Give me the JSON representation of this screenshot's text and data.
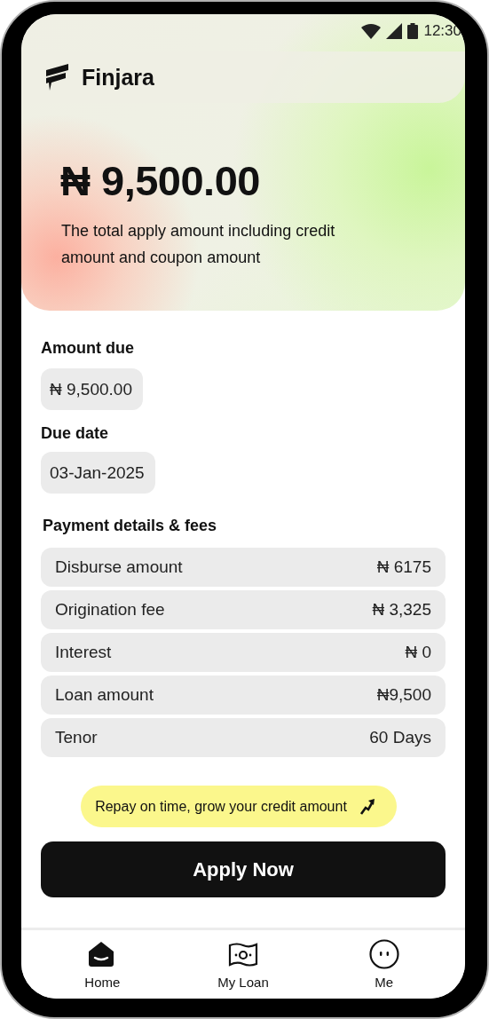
{
  "status_bar": {
    "time": "12:30"
  },
  "app": {
    "name": "Finjara"
  },
  "hero": {
    "amount": "₦ 9,500.00",
    "description": "The total apply amount including credit amount and coupon amount"
  },
  "amount_due": {
    "label": "Amount due",
    "value": "₦ 9,500.00"
  },
  "due_date": {
    "label": "Due date",
    "value": "03-Jan-2025"
  },
  "fees": {
    "title": "Payment details & fees",
    "rows": [
      {
        "label": "Disburse amount",
        "value": "₦ 6175"
      },
      {
        "label": "Origination fee",
        "value": "₦ 3,325"
      },
      {
        "label": "Interest",
        "value": "₦ 0"
      },
      {
        "label": "Loan amount",
        "value": "₦9,500"
      },
      {
        "label": "Tenor",
        "value": "60 Days"
      }
    ]
  },
  "tip": "Repay on time, grow your credit amount",
  "apply_button": "Apply Now",
  "nav": [
    {
      "label": "Home",
      "kind": "home",
      "selected": true
    },
    {
      "label": "My Loan",
      "kind": "loan",
      "selected": false
    },
    {
      "label": "Me",
      "kind": "me",
      "selected": false
    }
  ]
}
